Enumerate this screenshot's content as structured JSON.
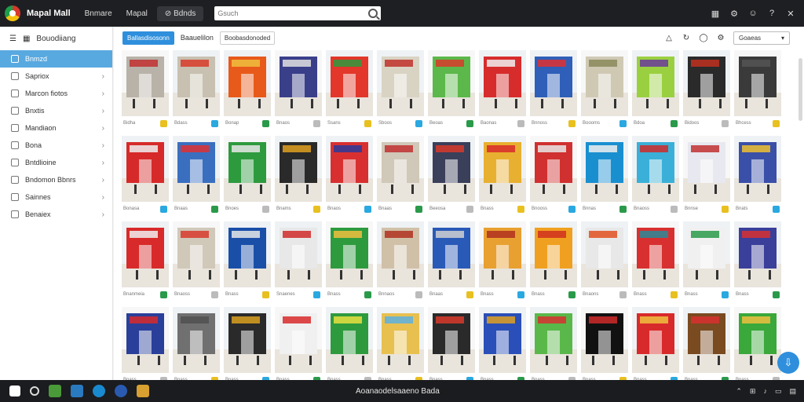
{
  "window": {
    "app_title": "Mapal Mall",
    "menu": [
      "Bnmare",
      "Mapal",
      "Bdnds"
    ],
    "search_placeholder": "Gsuch"
  },
  "sidebar": {
    "header": "Bouodiiang",
    "items": [
      {
        "label": "Bnmzd",
        "active": true
      },
      {
        "label": "Sapriox",
        "active": false
      },
      {
        "label": "Marcon fiotos",
        "active": false
      },
      {
        "label": "Bnxtis",
        "active": false
      },
      {
        "label": "Mandiaon",
        "active": false
      },
      {
        "label": "Bona",
        "active": false
      },
      {
        "label": "Bntdlioine",
        "active": false
      },
      {
        "label": "Bndomon Bbnrs",
        "active": false
      },
      {
        "label": "Sainnes",
        "active": false
      },
      {
        "label": "Benaiex",
        "active": false
      }
    ]
  },
  "toolbar": {
    "primary_button": "Ballasdisosonn",
    "label": "Baauelilon",
    "chip": "Boobasdonoded",
    "sort_label": "Goaeas"
  },
  "colors": {
    "accent": "#2f8fdc",
    "sidebar_active": "#58a9e0",
    "titlebar": "#1e1f22"
  },
  "tiles": [
    {
      "c": "#b8b2a8",
      "s": "#c03030",
      "m": "Bidha"
    },
    {
      "c": "#c8c0b0",
      "s": "#d83a2a",
      "m": "Bdass"
    },
    {
      "c": "#e85a1a",
      "s": "#f0c040",
      "m": "Bonap"
    },
    {
      "c": "#3a3f8a",
      "s": "#e0e0e0",
      "m": "Bnaos"
    },
    {
      "c": "#e2372a",
      "s": "#2e9a3e",
      "m": "Ssans"
    },
    {
      "c": "#d9d3c4",
      "s": "#c0302a",
      "m": "Sboos"
    },
    {
      "c": "#5cb84a",
      "s": "#d83a2a",
      "m": "Beoas"
    },
    {
      "c": "#d72c2c",
      "s": "#f0f0f0",
      "m": "Baonas"
    },
    {
      "c": "#2f5fb8",
      "s": "#e03030",
      "m": "Bnnoss"
    },
    {
      "c": "#cfc9b4",
      "s": "#8a8a5a",
      "m": "Boooms"
    },
    {
      "c": "#9ad040",
      "s": "#6a3a9a",
      "m": "Bdoa"
    },
    {
      "c": "#2a2a2a",
      "s": "#c03020",
      "m": "Bidoos"
    },
    {
      "c": "#3a3a3a",
      "s": "#555",
      "m": "Bhcess"
    },
    {
      "c": "#d62a2a",
      "s": "#f0f0f0",
      "m": "Bonasa"
    },
    {
      "c": "#3a6fc0",
      "s": "#e03030",
      "m": "Bnaas"
    },
    {
      "c": "#2e9a3e",
      "s": "#e8e8e8",
      "m": "Bnoes"
    },
    {
      "c": "#2a2a2a",
      "s": "#e0a020",
      "m": "Bnams"
    },
    {
      "c": "#d83030",
      "s": "#2a3a9a",
      "m": "Bnaos"
    },
    {
      "c": "#d0c8b8",
      "s": "#c03030",
      "m": "Bnaas"
    },
    {
      "c": "#3a3f5a",
      "s": "#d83a2a",
      "m": "Beeosa"
    },
    {
      "c": "#e8b030",
      "s": "#d82a2a",
      "m": "Bnass"
    },
    {
      "c": "#d03030",
      "s": "#e8e8e8",
      "m": "Bnooss"
    },
    {
      "c": "#1a8fd0",
      "s": "#f0f0f0",
      "m": "Bnnas"
    },
    {
      "c": "#3ab0d8",
      "s": "#d02a2a",
      "m": "Bnaoss"
    },
    {
      "c": "#e8e8f0",
      "s": "#c03030",
      "m": "Bnnse"
    },
    {
      "c": "#3a4fa8",
      "s": "#f0c030",
      "m": "Bnats"
    },
    {
      "c": "#d82a2a",
      "s": "#f0f0f0",
      "m": "Bnanmeia"
    },
    {
      "c": "#d0c8b8",
      "s": "#d83a2a",
      "m": "Bnaoss"
    },
    {
      "c": "#1a4fa8",
      "s": "#e8e8e8",
      "m": "Bnass"
    },
    {
      "c": "#e8e8e8",
      "s": "#d02a2a",
      "m": "Snaenes"
    },
    {
      "c": "#2e9a3e",
      "s": "#f0c040",
      "m": "Bnass"
    },
    {
      "c": "#d0c0a8",
      "s": "#b03020",
      "m": "Bnnaos"
    },
    {
      "c": "#2a5ab8",
      "s": "#d0d0d0",
      "m": "Bnaas"
    },
    {
      "c": "#e8a030",
      "s": "#b03020",
      "m": "Bnass"
    },
    {
      "c": "#f0a020",
      "s": "#d03020",
      "m": "Bnass"
    },
    {
      "c": "#e8e8e8",
      "s": "#e05020",
      "m": "Bnaons"
    },
    {
      "c": "#d83030",
      "s": "#2a8a9a",
      "m": "Bnass"
    },
    {
      "c": "#f0f0f0",
      "s": "#2a9a4a",
      "m": "Bnass"
    },
    {
      "c": "#3a3f9a",
      "s": "#d83030",
      "m": "Bnass"
    },
    {
      "c": "#2a3f9a",
      "s": "#d82a2a",
      "m": "Bnass"
    },
    {
      "c": "#707070",
      "s": "#505050",
      "m": "Bnass"
    },
    {
      "c": "#2a2a2a",
      "s": "#d8a020",
      "m": "Bnass"
    },
    {
      "c": "#f0f0f0",
      "s": "#d82a2a",
      "m": "Bnass"
    },
    {
      "c": "#2e9a3e",
      "s": "#e8e040",
      "m": "Bnass"
    },
    {
      "c": "#e8c050",
      "s": "#5ab0e0",
      "m": "Bnass"
    },
    {
      "c": "#2a2a2a",
      "s": "#d83a2a",
      "m": "Bnass"
    },
    {
      "c": "#2a4fb8",
      "s": "#e0a020",
      "m": "Bnass"
    },
    {
      "c": "#5ab84a",
      "s": "#d83030",
      "m": "Bnass"
    },
    {
      "c": "#111111",
      "s": "#d02a2a",
      "m": "Bnass"
    },
    {
      "c": "#d82a2a",
      "s": "#f0c040",
      "m": "Bnass"
    },
    {
      "c": "#7a4a20",
      "s": "#d83030",
      "m": "Bnass"
    },
    {
      "c": "#3aa83a",
      "s": "#f0c040",
      "m": "Bnass"
    }
  ],
  "taskbar": {
    "center_label": "Aoanaodelsaaeno Bada"
  }
}
